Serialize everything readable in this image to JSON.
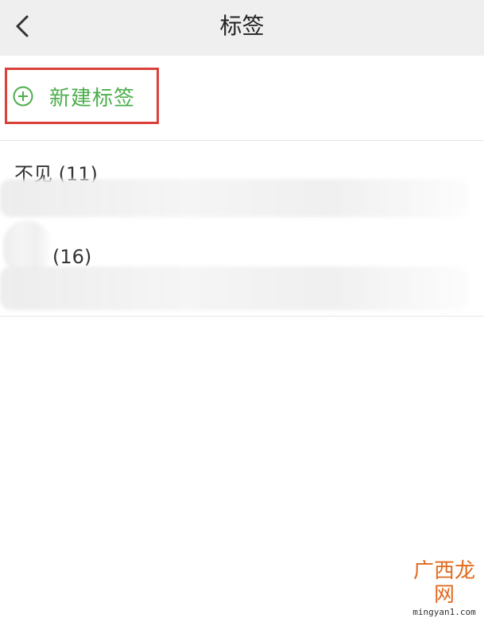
{
  "header": {
    "title": "标签",
    "back_icon": "chevron-left-icon"
  },
  "new_tag": {
    "label": "新建标签",
    "icon": "plus-circle-icon"
  },
  "tags": [
    {
      "label": "不见 (11)"
    },
    {
      "label": "(16)"
    }
  ],
  "colors": {
    "accent_green": "#4cae4c",
    "annotation_red": "#d9413a",
    "header_bg": "#efefef"
  },
  "watermark": {
    "logo": "广西龙网",
    "url": "mingyan1.com"
  }
}
